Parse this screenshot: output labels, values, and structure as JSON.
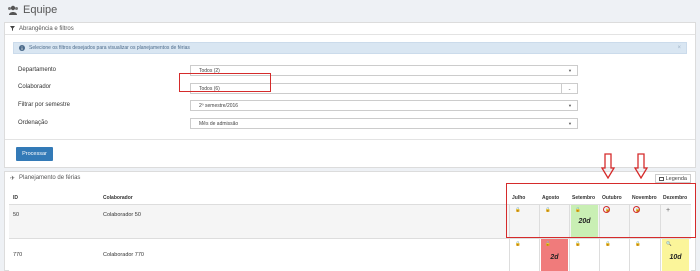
{
  "page": {
    "title": "Equipe"
  },
  "filters_panel": {
    "title": "Abrangência e filtros",
    "info_message": "Selecione os filtros desejados para visualizar os planejamentos de férias",
    "fields": [
      {
        "label": "Departamento",
        "value": "Todos (2)"
      },
      {
        "label": "Colaborador",
        "value": "Todos (6)"
      },
      {
        "label": "Filtrar por semestre",
        "value": "2º semestre/2016"
      },
      {
        "label": "Ordenação",
        "value": "Mês de admissão"
      }
    ],
    "process_label": "Processar"
  },
  "planning_panel": {
    "title": "Planejamento de férias",
    "legend_label": "Legenda",
    "columns": {
      "id": "ID",
      "colaborador": "Colaborador",
      "months": [
        "Julho",
        "Agosto",
        "Setembro",
        "Outubro",
        "Novembro",
        "Dezembro"
      ]
    },
    "rows": [
      {
        "id": "50",
        "name": "Colaborador 50",
        "cells": [
          {
            "icon": "lock-icon",
            "days": ""
          },
          {
            "icon": "lock-icon",
            "days": ""
          },
          {
            "icon": "lock-icon",
            "days": "20d",
            "color": "#c9efb4"
          },
          {
            "icon": "lock-icon",
            "days": "",
            "circled": true
          },
          {
            "icon": "lock-icon",
            "days": "",
            "circled": true
          },
          {
            "icon": "plus-icon",
            "days": ""
          }
        ]
      },
      {
        "id": "770",
        "name": "Colaborador 770",
        "cells": [
          {
            "icon": "lock-icon",
            "days": ""
          },
          {
            "icon": "lock-icon",
            "days": "2d",
            "color": "#f07b7b"
          },
          {
            "icon": "lock-icon",
            "days": ""
          },
          {
            "icon": "lock-icon",
            "days": ""
          },
          {
            "icon": "lock-icon",
            "days": ""
          },
          {
            "icon": "search-icon",
            "days": "10d",
            "color": "#fbf59a"
          }
        ]
      }
    ]
  },
  "annotation_color": "#d52b2b"
}
